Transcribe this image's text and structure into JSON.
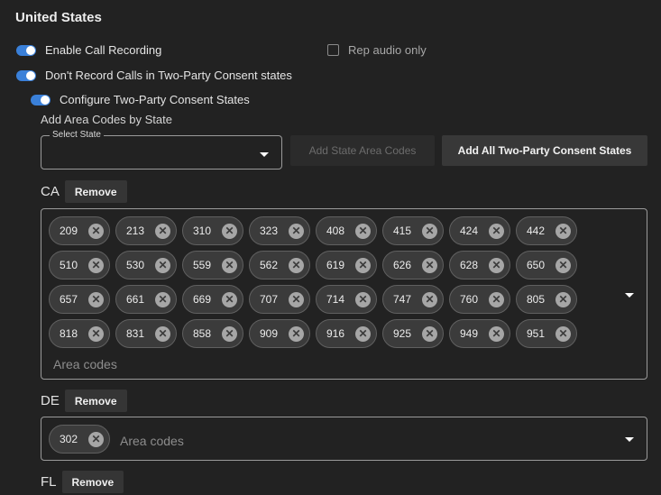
{
  "section_title": "United States",
  "settings": {
    "enable_recording": "Enable Call Recording",
    "rep_audio_only": "Rep audio only",
    "dont_record": "Don't Record Calls in Two-Party Consent states",
    "configure": "Configure Two-Party Consent States"
  },
  "area_codes_heading": "Add Area Codes by State",
  "select_state": {
    "label": "Select State",
    "value": ""
  },
  "buttons": {
    "add_state_area_codes": "Add State Area Codes",
    "add_all_two_party": "Add All Two-Party Consent States",
    "remove": "Remove"
  },
  "area_code_placeholder": "Area codes",
  "states": [
    {
      "code": "CA",
      "area_codes": [
        "209",
        "213",
        "310",
        "323",
        "408",
        "415",
        "424",
        "442",
        "510",
        "530",
        "559",
        "562",
        "619",
        "626",
        "628",
        "650",
        "657",
        "661",
        "669",
        "707",
        "714",
        "747",
        "760",
        "805",
        "818",
        "831",
        "858",
        "909",
        "916",
        "925",
        "949",
        "951"
      ]
    },
    {
      "code": "DE",
      "area_codes": [
        "302"
      ]
    },
    {
      "code": "FL",
      "area_codes": []
    }
  ],
  "icons": {
    "chip_remove": "close-circle-icon",
    "dropdown": "caret-down-icon"
  },
  "colors": {
    "toggle_on": "#3a80d9",
    "background": "#222222"
  }
}
